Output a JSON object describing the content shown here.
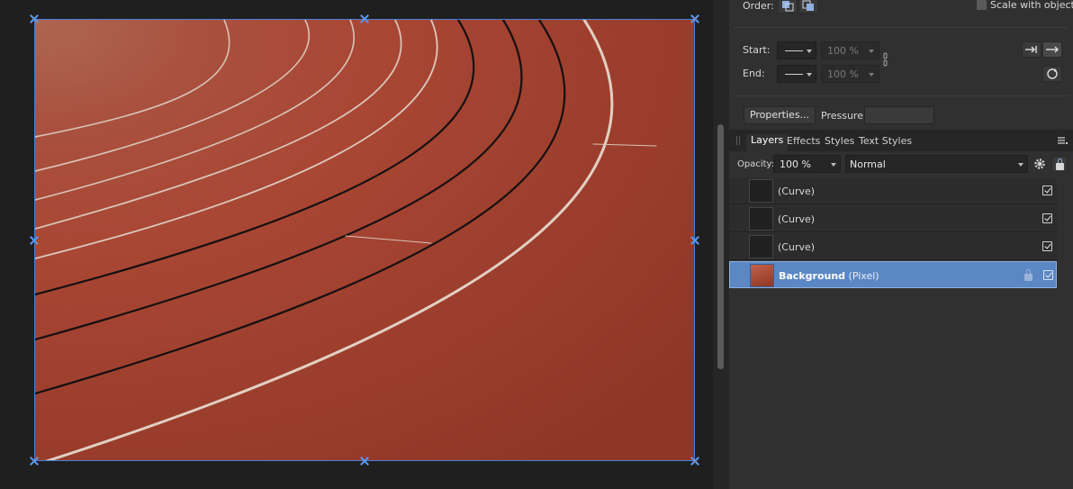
{
  "panel": {
    "order_label": "Order:",
    "scale_with_object": "Scale with object",
    "start_label": "Start:",
    "end_label": "End:",
    "start_percent": "100 %",
    "end_percent": "100 %",
    "properties_button": "Properties...",
    "pressure_label": "Pressure:"
  },
  "layers_panel": {
    "tabs": [
      "Layers",
      "Effects",
      "Styles",
      "Text Styles"
    ],
    "opacity_label": "Opacity:",
    "opacity_value": "100 %",
    "blend_mode": "Normal",
    "layers": [
      {
        "name": "(Curve)",
        "visible": true,
        "selected": false
      },
      {
        "name": "(Curve)",
        "visible": true,
        "selected": false
      },
      {
        "name": "(Curve)",
        "visible": true,
        "selected": false
      },
      {
        "name": "Background",
        "type": "(Pixel)",
        "visible": true,
        "selected": true,
        "locked": true
      }
    ]
  },
  "colors": {
    "track": "#b14a34",
    "selection": "#5b87c4",
    "panel": "#303030"
  }
}
